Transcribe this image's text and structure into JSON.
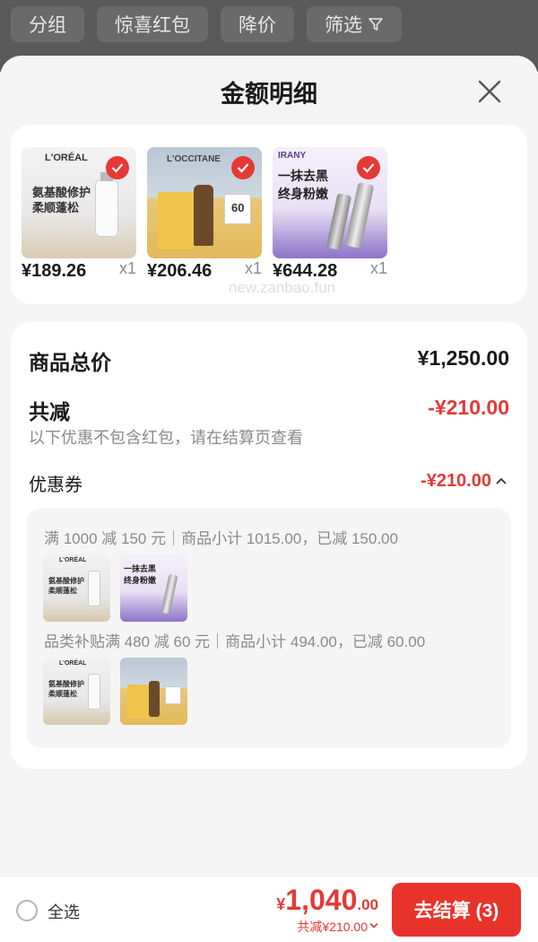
{
  "filter_bar": {
    "chips": [
      "分组",
      "惊喜红包",
      "降价",
      "筛选"
    ]
  },
  "sheet": {
    "title": "金额明细"
  },
  "products": [
    {
      "brand": "L'ORÉAL",
      "image_text": "氨基酸修护\n柔顺蓬松",
      "price": "¥189.26",
      "qty": "x1"
    },
    {
      "brand": "L'OCCITANE",
      "image_text": "60",
      "price": "¥206.46",
      "qty": "x1"
    },
    {
      "brand": "IRANY",
      "image_text": "一抹去黑\n终身粉嫩",
      "price": "¥644.28",
      "qty": "x1"
    }
  ],
  "summary": {
    "total_label": "商品总价",
    "total_value": "¥1,250.00",
    "reduce_label": "共减",
    "reduce_value": "-¥210.00",
    "note": "以下优惠不包含红包，请在结算页查看",
    "coupon_label": "优惠券",
    "coupon_value": "-¥210.00"
  },
  "coupon_details": [
    {
      "rule": "满 1000 减 150 元｜商品小计 1015.00，已减 150.00"
    },
    {
      "rule": "品类补贴满 480 减 60 元｜商品小计 494.00，已减 60.00"
    }
  ],
  "watermark": "new.zanbao.fun",
  "bottom_bar": {
    "select_all": "全选",
    "total_yen": "¥",
    "total_int": "1,040",
    "total_dec": ".00",
    "total_sub": "共减¥210.00",
    "checkout": "去结算 (3)"
  },
  "colors": {
    "accent": "#e53935",
    "checkout_bg": "#e8332b"
  }
}
